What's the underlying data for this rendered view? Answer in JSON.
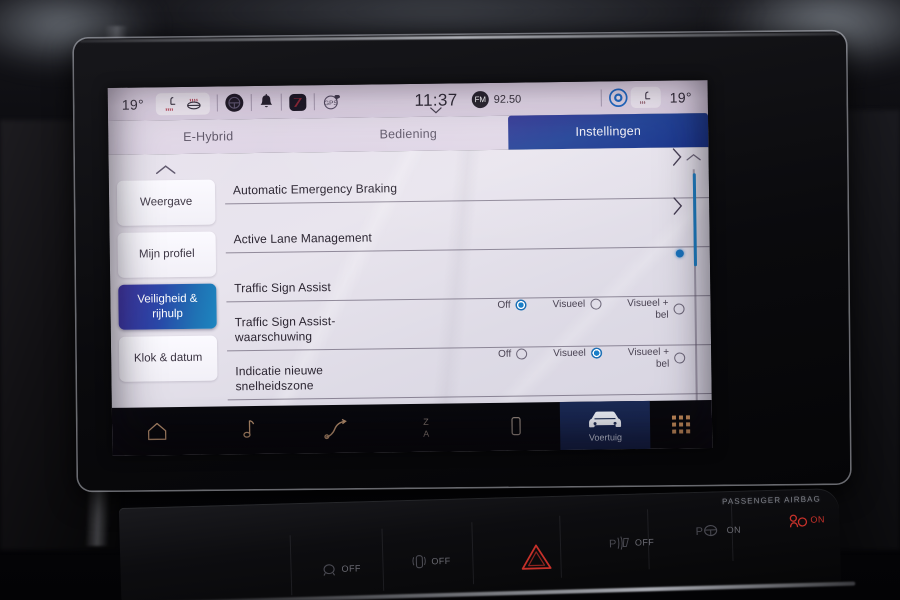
{
  "device": {
    "type": "car-infotainment-touchscreen",
    "ui_language": "nl"
  },
  "status_bar": {
    "left_temperature": "19°",
    "right_temperature": "19°",
    "time": "11:37",
    "radio_band": "FM",
    "radio_frequency": "92.50",
    "icons": [
      "seat-heater-left-icon",
      "seat-heater-right-icon",
      "steering-wheel-heater-icon",
      "notification-bell-icon",
      "media-app-icon",
      "gps-icon",
      "bluetooth-status-icon",
      "seat-heater-passenger-icon"
    ]
  },
  "tabs": [
    {
      "label": "E-Hybrid",
      "active": false
    },
    {
      "label": "Bediening",
      "active": false
    },
    {
      "label": "Instellingen",
      "active": true
    }
  ],
  "sidebar": {
    "scroll_up_icon": "chevron-up-icon",
    "scroll_down_icon": "chevron-down-icon",
    "items": [
      {
        "label": "Weergave",
        "active": false
      },
      {
        "label": "Mijn profiel",
        "active": false
      },
      {
        "label": "Veiligheid & rijhulp",
        "line1": "Veiligheid &",
        "line2": "rijhulp",
        "active": true
      },
      {
        "label": "Klok & datum",
        "active": false
      }
    ]
  },
  "settings_list": {
    "rows": [
      {
        "label": "Automatic Emergency Braking",
        "control": "chevron",
        "line1": "Automatic Emergency Braking",
        "line2": ""
      },
      {
        "label": "Active Lane Management",
        "control": "chevron",
        "line1": "Active Lane Management",
        "line2": ""
      },
      {
        "label": "Traffic Sign Assist",
        "control": "toggle-on",
        "line1": "Traffic Sign Assist",
        "line2": ""
      },
      {
        "label": "Traffic Sign Assist-waarschuwing",
        "control": "radio-group",
        "line1": "Traffic Sign Assist-",
        "line2": "waarschuwing",
        "options": [
          {
            "label": "Off",
            "selected": true
          },
          {
            "label": "Visueel",
            "selected": false
          },
          {
            "label": "Visueel + bel",
            "l1": "Visueel +",
            "l2": "bel",
            "selected": false
          }
        ]
      },
      {
        "label": "Indicatie nieuwe snelheidszone",
        "control": "radio-group",
        "line1": "Indicatie nieuwe",
        "line2": "snelheidszone",
        "options": [
          {
            "label": "Off",
            "selected": false
          },
          {
            "label": "Visueel",
            "selected": true
          },
          {
            "label": "Visueel + bel",
            "l1": "Visueel +",
            "l2": "bel",
            "selected": false
          }
        ]
      }
    ],
    "scrollbar": {
      "up_icon": "chevron-up-icon",
      "down_icon": "chevron-down-icon",
      "position": "top"
    }
  },
  "bottom_nav": [
    {
      "icon": "home-icon",
      "label": "",
      "active": false
    },
    {
      "icon": "music-note-icon",
      "label": "",
      "active": false
    },
    {
      "icon": "navigation-route-icon",
      "label": "",
      "active": false
    },
    {
      "icon": "contacts-az-icon",
      "label": "",
      "active": false
    },
    {
      "icon": "phone-device-icon",
      "label": "",
      "active": false
    },
    {
      "icon": "car-icon",
      "label": "Voertuig",
      "active": true
    },
    {
      "icon": "apps-grid-icon",
      "label": "",
      "active": false
    }
  ],
  "dash_controls": {
    "passenger_airbag_label": "PASSENGER AIRBAG",
    "buttons": [
      {
        "icon": "parking-sensor-front-icon",
        "label": "OFF"
      },
      {
        "icon": "parking-sensor-rear-icon",
        "label": "OFF"
      },
      {
        "icon": "hazard-triangle-icon",
        "label": ""
      },
      {
        "icon": "park-assist-icon",
        "label": "OFF"
      },
      {
        "icon": "lane-keep-steering-icon",
        "label": "ON"
      },
      {
        "icon": "airbag-indicator-icon",
        "label": "ON"
      }
    ]
  },
  "colors": {
    "accent_blue": "#1d7fc4",
    "tab_active": "#1d3f95",
    "sidebar_active_start": "#3b2f9e",
    "sidebar_active_end": "#1e86c0",
    "screen_bg": "#e6e1ec",
    "status_bar_bg": "#ddd0e2",
    "nav_bg": "#0a0a0f",
    "hazard_red": "#c6312a"
  }
}
